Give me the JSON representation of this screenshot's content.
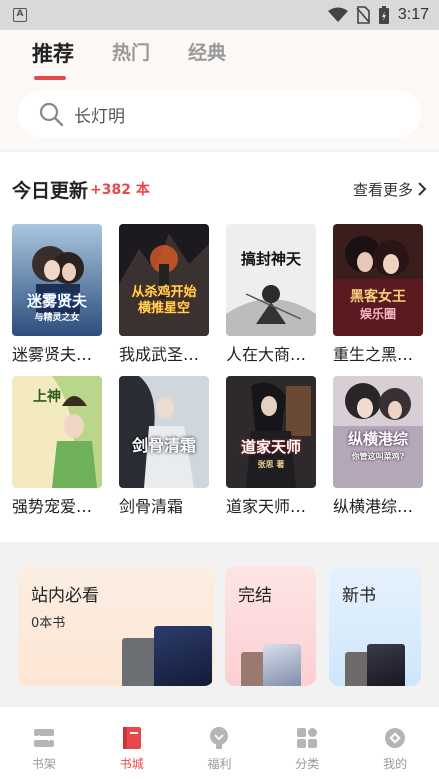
{
  "status": {
    "time": "3:17"
  },
  "tabs": [
    {
      "label": "推荐",
      "active": true
    },
    {
      "label": "热门",
      "active": false
    },
    {
      "label": "经典",
      "active": false
    }
  ],
  "search": {
    "value": "长灯明"
  },
  "daily": {
    "title": "今日更新",
    "count": "+382 本",
    "see_more": "查看更多"
  },
  "books": [
    {
      "title": "迷雾贤夫…",
      "cover_text": "迷雾贤夫",
      "cover_sub": "与精灵之女"
    },
    {
      "title": "我成武圣…",
      "cover_text": "从杀鸡开始",
      "cover_sub": "横推星空"
    },
    {
      "title": "人在大商…",
      "cover_text": "搞封神天",
      "cover_sub": ""
    },
    {
      "title": "重生之黑…",
      "cover_text": "黑客女王",
      "cover_sub": "娱乐圈"
    },
    {
      "title": "强势宠爱…",
      "cover_text": "上神",
      "cover_sub": ""
    },
    {
      "title": "剑骨清霜",
      "cover_text": "剑骨清霜",
      "cover_sub": ""
    },
    {
      "title": "道家天师…",
      "cover_text": "道家天师",
      "cover_sub": "张思 著"
    },
    {
      "title": "纵横港综…",
      "cover_text": "纵横港综",
      "cover_sub": "你管这叫菜鸡?"
    }
  ],
  "categories": {
    "must_read": {
      "title": "站内必看",
      "sub": "0本书"
    },
    "finished": {
      "title": "完结"
    },
    "new_books": {
      "title": "新书"
    }
  },
  "nav": [
    {
      "label": "书架",
      "icon": "bookshelf-icon",
      "active": false
    },
    {
      "label": "书城",
      "icon": "book-icon",
      "active": true
    },
    {
      "label": "福利",
      "icon": "gift-icon",
      "active": false
    },
    {
      "label": "分类",
      "icon": "grid-icon",
      "active": false
    },
    {
      "label": "我的",
      "icon": "profile-icon",
      "active": false
    }
  ],
  "colors": {
    "accent": "#e8484a",
    "inactive": "#999999"
  }
}
